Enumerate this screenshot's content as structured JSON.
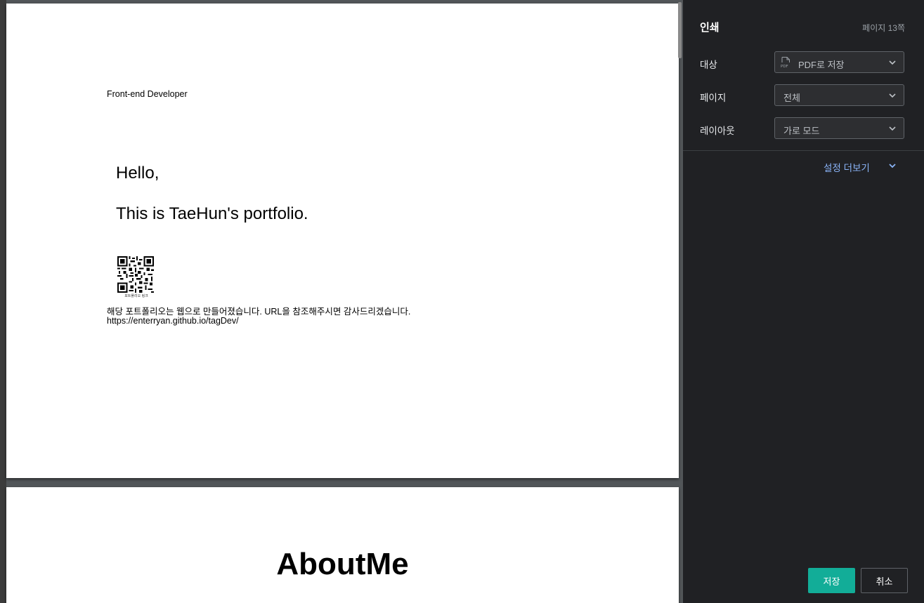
{
  "preview": {
    "page1": {
      "role": "Front-end Developer",
      "greeting": "Hello,",
      "intro": "This is TaeHun's portfolio.",
      "qr_caption": "포트폴리오 링크",
      "notice": "해당 포트폴리오는 웹으로 만들어졌습니다. URL을 참조해주시면 감사드리겠습니다.",
      "url": "https://enterryan.github.io/tagDev/"
    },
    "page2": {
      "heading": "AboutMe"
    }
  },
  "print": {
    "title": "인쇄",
    "page_count": "페이지 13쪽",
    "destination_label": "대상",
    "destination_value": "PDF로 저장",
    "destination_icon": "pdf-file-icon",
    "pages_label": "페이지",
    "pages_value": "전체",
    "layout_label": "레이아웃",
    "layout_value": "가로 모드",
    "more_settings": "설정 더보기",
    "save_button": "저장",
    "cancel_button": "취소"
  },
  "colors": {
    "sidebar_bg": "#202124",
    "preview_bg": "#525659",
    "accent_link": "#8ab4f8",
    "save_button_bg": "#12ad98"
  }
}
